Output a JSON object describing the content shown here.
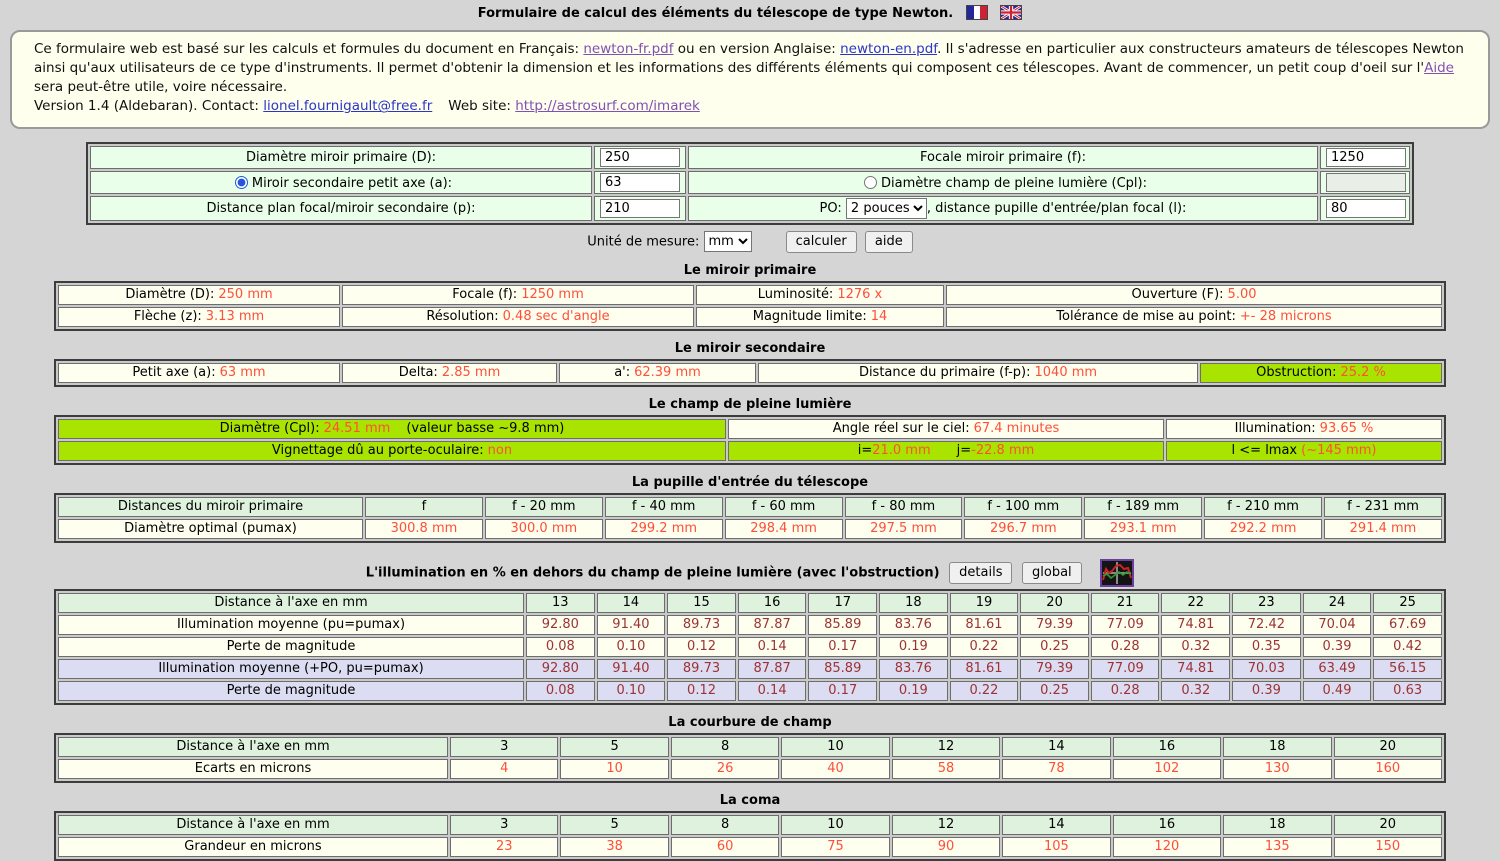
{
  "page": {
    "title": "Formulaire de calcul des éléments du télescope de type Newton."
  },
  "colors": {
    "value_red": "#ff4f38",
    "table_value_dark_red": "#9b3333",
    "highlight_green": "#a8e400",
    "header_green": "#def2de",
    "form_green": "#e9ffe9",
    "row_lavender": "#dcdcf2",
    "cell_ivory": "#fffff0",
    "intro_bg": "#ffffee",
    "page_bg": "#d5d5d5"
  },
  "intro": {
    "text_before_fr": "Ce formulaire web est basé sur les calculs et formules du document en Français: ",
    "link_fr": "newton-fr.pdf",
    "text_between": " ou en version Anglaise: ",
    "link_en": "newton-en.pdf",
    "text_after_en": ". Il s'adresse en particulier aux constructeurs amateurs de télescopes Newton ainsi qu'aux utilisateurs de ce type d'instruments. Il permet d'obtenir la dimension et les informations des différents éléments qui composent ces télescopes. Avant de commencer, un petit coup d'oeil sur l'",
    "link_aide": "Aide",
    "text_end": " sera peut-être utile, voire nécessaire.",
    "version_prefix": "Version 1.4 (Aldebaran). Contact: ",
    "contact_link": "lionel.fournigault@free.fr",
    "web_label": "Web site: ",
    "web_link": "http://astrosurf.com/imarek"
  },
  "form": {
    "d_label": "Diamètre miroir primaire (D):",
    "d_value": "250",
    "f_label": "Focale miroir primaire (f):",
    "f_value": "1250",
    "a_label": "Miroir secondaire petit axe (a):",
    "a_value": "63",
    "cpl_label": "Diamètre champ de pleine lumière (Cpl):",
    "cpl_value": "",
    "p_label": "Distance plan focal/miroir secondaire (p):",
    "p_value": "210",
    "po_label": "PO:",
    "po_value": "2 pouces",
    "l_label": ", distance pupille d'entrée/plan focal (l):",
    "l_value": "80",
    "unit_label": "Unité de mesure:",
    "unit_value": "mm",
    "calc_button": "calculer",
    "help_button": "aide"
  },
  "primaire": {
    "heading": "Le miroir primaire",
    "cells": [
      {
        "label": "Diamètre (D):",
        "value": "250 mm"
      },
      {
        "label": "Focale (f):",
        "value": "1250 mm"
      },
      {
        "label": "Luminosité:",
        "value": "1276 x"
      },
      {
        "label": "Ouverture (F):",
        "value": "5.00"
      },
      {
        "label": "Flèche (z):",
        "value": "3.13 mm"
      },
      {
        "label": "Résolution:",
        "value": "0.48 sec d'angle"
      },
      {
        "label": "Magnitude limite:",
        "value": "14"
      },
      {
        "label": "Tolérance de mise au point:",
        "value": "+- 28 microns"
      }
    ]
  },
  "secondaire": {
    "heading": "Le miroir secondaire",
    "cells": [
      {
        "label": "Petit axe (a):",
        "value": "63 mm"
      },
      {
        "label": "Delta:",
        "value": "2.85 mm"
      },
      {
        "label": "a':",
        "value": "62.39 mm"
      },
      {
        "label": "Distance du primaire (f-p):",
        "value": "1040 mm"
      },
      {
        "label": "Obstruction:",
        "value": "25.2 %"
      }
    ]
  },
  "champ": {
    "heading": "Le champ de pleine lumière",
    "cpl": {
      "label": "Diamètre (Cpl):",
      "value": "24.51 mm",
      "note": "(valeur basse ~9.8 mm)"
    },
    "angle": {
      "label": "Angle réel sur le ciel:",
      "value": "67.4 minutes"
    },
    "illum": {
      "label": "Illumination:",
      "value": "93.65 %"
    },
    "vignettage": {
      "label": "Vignettage dû au porte-oculaire:",
      "value": "non"
    },
    "ij": {
      "i_label": "i=",
      "i_value": "21.0 mm",
      "j_label": "j=",
      "j_value": "-22.8 mm"
    },
    "lmax": {
      "label": "l <= lmax",
      "value": "(~145 mm)"
    }
  },
  "pupille": {
    "heading": "La pupille d'entrée du télescope",
    "header_label": "Distances du miroir primaire",
    "headers": [
      "f",
      "f - 20 mm",
      "f - 40 mm",
      "f - 60 mm",
      "f - 80 mm",
      "f - 100 mm",
      "f - 189 mm",
      "f - 210 mm",
      "f - 231 mm"
    ],
    "row_label": "Diamètre optimal (pumax)",
    "values": [
      "300.8 mm",
      "300.0 mm",
      "299.2 mm",
      "298.4 mm",
      "297.5 mm",
      "296.7 mm",
      "293.1 mm",
      "292.2 mm",
      "291.4 mm"
    ]
  },
  "illumination": {
    "heading": "L'illumination en % en dehors du champ de pleine lumière (avec l'obstruction)",
    "details_button": "details",
    "global_button": "global",
    "header_label": "Distance à l'axe en mm",
    "distances": [
      "13",
      "14",
      "15",
      "16",
      "17",
      "18",
      "19",
      "20",
      "21",
      "22",
      "23",
      "24",
      "25"
    ],
    "rows": [
      {
        "label": "Illumination moyenne (pu=pumax)",
        "values": [
          "92.80",
          "91.40",
          "89.73",
          "87.87",
          "85.89",
          "83.76",
          "81.61",
          "79.39",
          "77.09",
          "74.81",
          "72.42",
          "70.04",
          "67.69"
        ]
      },
      {
        "label": "Perte de magnitude",
        "values": [
          "0.08",
          "0.10",
          "0.12",
          "0.14",
          "0.17",
          "0.19",
          "0.22",
          "0.25",
          "0.28",
          "0.32",
          "0.35",
          "0.39",
          "0.42"
        ]
      },
      {
        "label": "Illumination moyenne (+PO, pu=pumax)",
        "values": [
          "92.80",
          "91.40",
          "89.73",
          "87.87",
          "85.89",
          "83.76",
          "81.61",
          "79.39",
          "77.09",
          "74.81",
          "70.03",
          "63.49",
          "56.15"
        ]
      },
      {
        "label": "Perte de magnitude",
        "values": [
          "0.08",
          "0.10",
          "0.12",
          "0.14",
          "0.17",
          "0.19",
          "0.22",
          "0.25",
          "0.28",
          "0.32",
          "0.39",
          "0.49",
          "0.63"
        ]
      }
    ]
  },
  "courbure": {
    "heading": "La courbure de champ",
    "header_label": "Distance à l'axe en mm",
    "distances": [
      "3",
      "5",
      "8",
      "10",
      "12",
      "14",
      "16",
      "18",
      "20"
    ],
    "row_label": "Ecarts en microns",
    "values": [
      "4",
      "10",
      "26",
      "40",
      "58",
      "78",
      "102",
      "130",
      "160"
    ]
  },
  "coma": {
    "heading": "La coma",
    "header_label": "Distance à l'axe en mm",
    "distances": [
      "3",
      "5",
      "8",
      "10",
      "12",
      "14",
      "16",
      "18",
      "20"
    ],
    "row_label": "Grandeur en microns",
    "values": [
      "23",
      "38",
      "60",
      "75",
      "90",
      "105",
      "120",
      "135",
      "150"
    ]
  }
}
